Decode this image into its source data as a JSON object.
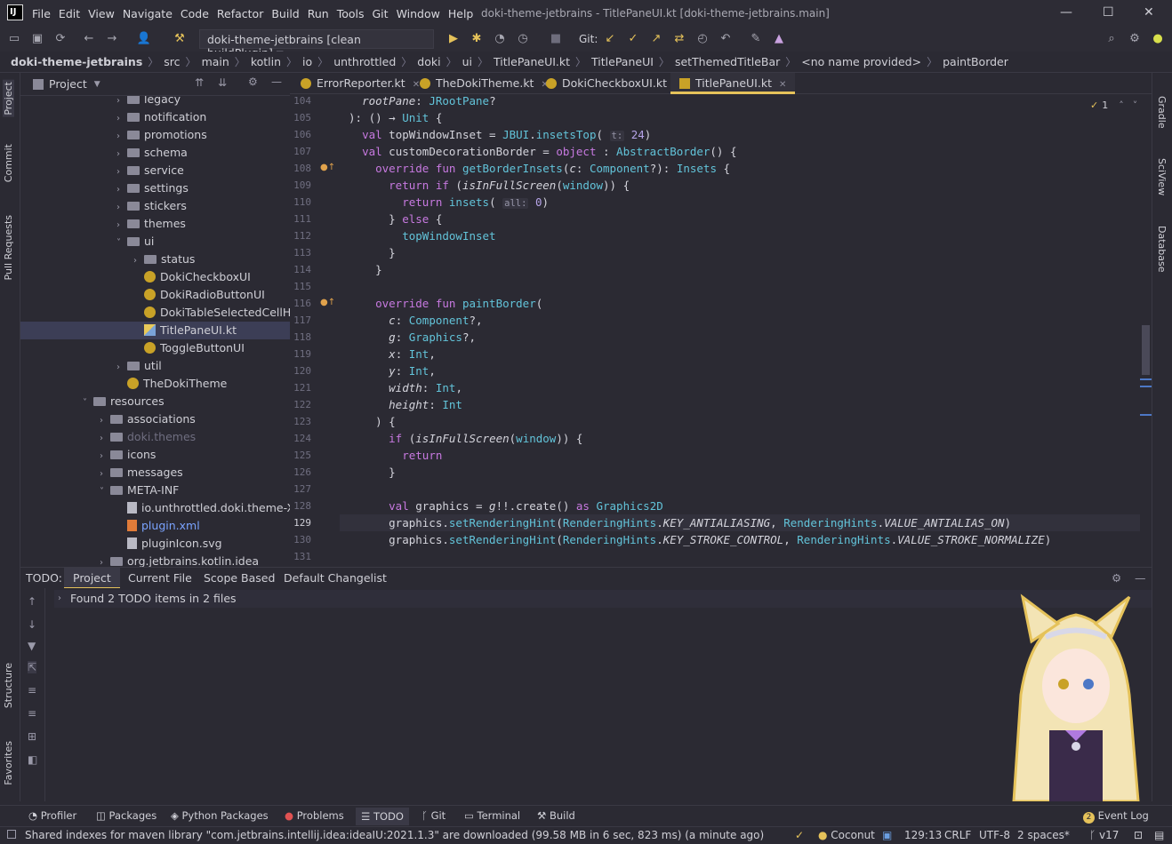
{
  "window": {
    "title": "doki-theme-jetbrains - TitlePaneUI.kt [doki-theme-jetbrains.main]",
    "logo": "IJ"
  },
  "menu": [
    "File",
    "Edit",
    "View",
    "Navigate",
    "Code",
    "Refactor",
    "Build",
    "Run",
    "Tools",
    "Git",
    "Window",
    "Help"
  ],
  "toolbar": {
    "run_config": "doki-theme-jetbrains [clean buildPlugin]",
    "git_label": "Git:"
  },
  "breadcrumb": [
    "doki-theme-jetbrains",
    "src",
    "main",
    "kotlin",
    "io",
    "unthrottled",
    "doki",
    "ui",
    "TitlePaneUI.kt",
    "TitlePaneUI",
    "setThemedTitleBar",
    "<no name provided>",
    "paintBorder"
  ],
  "project_panel": {
    "title": "Project",
    "tree": [
      {
        "label": "legacy",
        "type": "folder",
        "indent": 2,
        "arrow": "right"
      },
      {
        "label": "notification",
        "type": "folder",
        "indent": 2,
        "arrow": "right"
      },
      {
        "label": "promotions",
        "type": "folder",
        "indent": 2,
        "arrow": "right"
      },
      {
        "label": "schema",
        "type": "folder",
        "indent": 2,
        "arrow": "right"
      },
      {
        "label": "service",
        "type": "folder",
        "indent": 2,
        "arrow": "right"
      },
      {
        "label": "settings",
        "type": "folder",
        "indent": 2,
        "arrow": "right"
      },
      {
        "label": "stickers",
        "type": "folder",
        "indent": 2,
        "arrow": "right"
      },
      {
        "label": "themes",
        "type": "folder",
        "indent": 2,
        "arrow": "right"
      },
      {
        "label": "ui",
        "type": "folder",
        "indent": 2,
        "arrow": "down"
      },
      {
        "label": "status",
        "type": "folder",
        "indent": 3,
        "arrow": "right"
      },
      {
        "label": "DokiCheckboxUI",
        "type": "kt",
        "indent": 3,
        "arrow": ""
      },
      {
        "label": "DokiRadioButtonUI",
        "type": "kt",
        "indent": 3,
        "arrow": ""
      },
      {
        "label": "DokiTableSelectedCellHighl",
        "type": "kt",
        "indent": 3,
        "arrow": ""
      },
      {
        "label": "TitlePaneUI.kt",
        "type": "ktfile",
        "indent": 3,
        "arrow": "",
        "selected": true
      },
      {
        "label": "ToggleButtonUI",
        "type": "kt",
        "indent": 3,
        "arrow": ""
      },
      {
        "label": "util",
        "type": "folder",
        "indent": 2,
        "arrow": "right"
      },
      {
        "label": "TheDokiTheme",
        "type": "kt",
        "indent": 2,
        "arrow": ""
      },
      {
        "label": "resources",
        "type": "folder",
        "indent": 0,
        "arrow": "down"
      },
      {
        "label": "associations",
        "type": "folder",
        "indent": 1,
        "arrow": "right"
      },
      {
        "label": "doki.themes",
        "type": "folder",
        "indent": 1,
        "arrow": "right",
        "dim": true
      },
      {
        "label": "icons",
        "type": "folder",
        "indent": 1,
        "arrow": "right"
      },
      {
        "label": "messages",
        "type": "folder",
        "indent": 1,
        "arrow": "right"
      },
      {
        "label": "META-INF",
        "type": "folder",
        "indent": 1,
        "arrow": "down"
      },
      {
        "label": "io.unthrottled.doki.theme-XPat",
        "type": "file",
        "indent": 2,
        "arrow": ""
      },
      {
        "label": "plugin.xml",
        "type": "xml",
        "indent": 2,
        "arrow": "",
        "blue": true
      },
      {
        "label": "pluginIcon.svg",
        "type": "file",
        "indent": 2,
        "arrow": ""
      },
      {
        "label": "org.jetbrains.kotlin.idea",
        "type": "folder",
        "indent": 1,
        "arrow": "right"
      }
    ]
  },
  "editor_tabs": [
    {
      "label": "ErrorReporter.kt",
      "active": false
    },
    {
      "label": "TheDokiTheme.kt",
      "active": false
    },
    {
      "label": "DokiCheckboxUI.kt",
      "active": false
    },
    {
      "label": "TitlePaneUI.kt",
      "active": true
    }
  ],
  "editor": {
    "inspection_count": "1",
    "current_line": "129",
    "lines": [
      {
        "n": "104",
        "html": "  <span class=\"it\">rootPane</span>: <span class=\"ty\">JRootPane</span>?"
      },
      {
        "n": "105",
        "html": "): () → <span class=\"ty\">Unit</span> {"
      },
      {
        "n": "106",
        "html": "  <span class=\"kw\">val</span> topWindowInset = <span class=\"ty\">JBUI</span>.<span class=\"fn\">insetsTop</span>( <span class=\"hint\">t:</span> <span class=\"nm\">24</span>)"
      },
      {
        "n": "107",
        "html": "  <span class=\"kw\">val</span> customDecorationBorder = <span class=\"kw\">object</span> : <span class=\"ty\">AbstractBorder</span>() {"
      },
      {
        "n": "108",
        "html": "    <span class=\"kw\">override fun</span> <span class=\"fn\">getBorderInsets</span>(<span class=\"it\">c</span>: <span class=\"ty\">Component</span>?): <span class=\"ty\">Insets</span> {",
        "mark": true
      },
      {
        "n": "109",
        "html": "      <span class=\"kw\">return if</span> (<span class=\"it\">isInFullScreen</span>(<span class=\"ty\">window</span>)) {"
      },
      {
        "n": "110",
        "html": "        <span class=\"kw\">return</span> <span class=\"fn\">insets</span>( <span class=\"hint\">all:</span> <span class=\"nm\">0</span>)"
      },
      {
        "n": "111",
        "html": "      } <span class=\"kw\">else</span> {"
      },
      {
        "n": "112",
        "html": "        <span class=\"ty\">topWindowInset</span>"
      },
      {
        "n": "113",
        "html": "      }"
      },
      {
        "n": "114",
        "html": "    }"
      },
      {
        "n": "115",
        "html": ""
      },
      {
        "n": "116",
        "html": "    <span class=\"kw\">override fun</span> <span class=\"fn\">paintBorder</span>(",
        "mark": true
      },
      {
        "n": "117",
        "html": "      <span class=\"it\">c</span>: <span class=\"ty\">Component</span>?,"
      },
      {
        "n": "118",
        "html": "      <span class=\"it\">g</span>: <span class=\"ty\">Graphics</span>?,"
      },
      {
        "n": "119",
        "html": "      <span class=\"it\">x</span>: <span class=\"ty\">Int</span>,"
      },
      {
        "n": "120",
        "html": "      <span class=\"it\">y</span>: <span class=\"ty\">Int</span>,"
      },
      {
        "n": "121",
        "html": "      <span class=\"it\">width</span>: <span class=\"ty\">Int</span>,"
      },
      {
        "n": "122",
        "html": "      <span class=\"it\">height</span>: <span class=\"ty\">Int</span>"
      },
      {
        "n": "123",
        "html": "    ) {"
      },
      {
        "n": "124",
        "html": "      <span class=\"kw\">if</span> (<span class=\"it\">isInFullScreen</span>(<span class=\"ty\">window</span>)) {"
      },
      {
        "n": "125",
        "html": "        <span class=\"kw\">return</span>"
      },
      {
        "n": "126",
        "html": "      }"
      },
      {
        "n": "127",
        "html": ""
      },
      {
        "n": "128",
        "html": "      <span class=\"kw\">val</span> graphics = <span class=\"it\">g</span>!!.<span class=\"cs\">create</span>() <span class=\"kw\">as</span> <span class=\"ty\">Graphics2D</span>"
      },
      {
        "n": "129",
        "html": "      graphics.<span class=\"fn\">setRenderingHint</span>(<span class=\"ty\">RenderingHints</span>.<span class=\"it\">KEY_ANTIALIASING</span>, <span class=\"ty\">RenderingHints</span>.<span class=\"it\">VALUE_ANTIALIAS_ON</span>)"
      },
      {
        "n": "130",
        "html": "      graphics.<span class=\"fn\">setRenderingHint</span>(<span class=\"ty\">RenderingHints</span>.<span class=\"it\">KEY_STROKE_CONTROL</span>, <span class=\"ty\">RenderingHints</span>.<span class=\"it\">VALUE_STROKE_NORMALIZE</span>)"
      },
      {
        "n": "131",
        "html": ""
      }
    ]
  },
  "left_strip": [
    "Project",
    "Commit",
    "Pull Requests",
    "Structure",
    "Favorites"
  ],
  "right_strip": [
    "Gradle",
    "SciView",
    "Database"
  ],
  "todo": {
    "label": "TODO:",
    "tabs": [
      "Project",
      "Current File",
      "Scope Based",
      "Default Changelist"
    ],
    "active_tab": "Project",
    "result": "Found 2 TODO items in 2 files"
  },
  "bottom_tabs": [
    "Profiler",
    "Packages",
    "Python Packages",
    "Problems",
    "TODO",
    "Git",
    "Terminal",
    "Build"
  ],
  "event_log": {
    "count": "2",
    "label": "Event Log"
  },
  "status": {
    "message": "Shared indexes for maven library \"com.jetbrains.intellij.idea:ideaIU:2021.1.3\" are downloaded (99.58 MB in 6 sec, 823 ms) (a minute ago)",
    "theme": "Coconut",
    "position": "129:13",
    "line_sep": "CRLF",
    "encoding": "UTF-8",
    "indent": "2 spaces*",
    "branch": "v17"
  },
  "colors": {
    "accent": "#e5c25a",
    "background": "#2b2a33",
    "keyword": "#c779e0",
    "type": "#62c3d9"
  }
}
